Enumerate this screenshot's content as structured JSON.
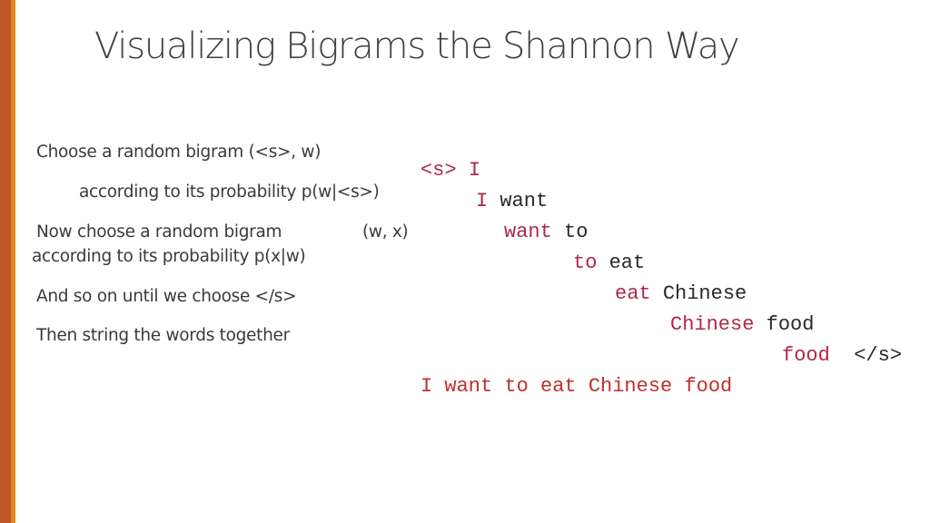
{
  "slide": {
    "title": "Visualizing Bigrams the Shannon Way",
    "accent_colors": {
      "dark": "#c0582a",
      "light": "#e8871f",
      "highlight": "#b0284a",
      "output": "#c0302a"
    },
    "bullets": [
      "Choose a random bigram (<s>, w)",
      "according to its probability p(w|<s>)",
      "Now choose a random bigram",
      "(w, x)",
      "according to its probability p(x|w)",
      "And so on until we choose </s>",
      "Then string the words together"
    ],
    "bigrams": [
      {
        "first": "<s>",
        "second": "I"
      },
      {
        "first": "I",
        "second": "want"
      },
      {
        "first": "want",
        "second": "to"
      },
      {
        "first": "to",
        "second": "eat"
      },
      {
        "first": "eat",
        "second": "Chinese"
      },
      {
        "first": "Chinese",
        "second": "food"
      },
      {
        "first": "food",
        "second": "</s>"
      }
    ],
    "result_sentence": "I want to eat Chinese food"
  }
}
